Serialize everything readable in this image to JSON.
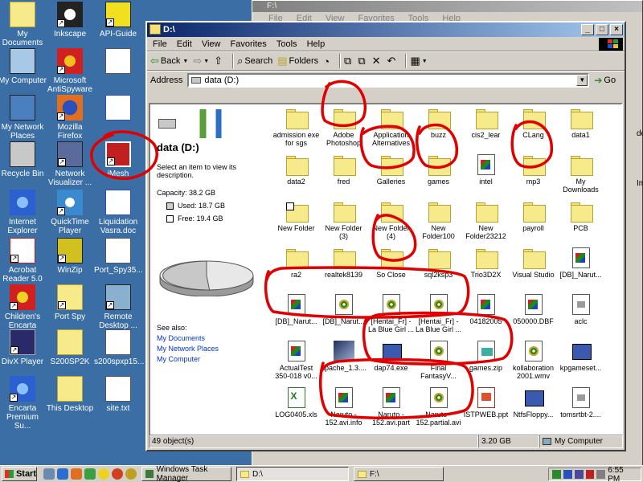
{
  "desktop": {
    "icons": [
      {
        "label": "My Documents"
      },
      {
        "label": "Inkscape"
      },
      {
        "label": "API-Guide"
      },
      {
        "label": "My Computer"
      },
      {
        "label": "Microsoft AntiSpyware"
      },
      {
        "label": ""
      },
      {
        "label": "My Network Places"
      },
      {
        "label": "Mozilla Firefox"
      },
      {
        "label": ""
      },
      {
        "label": "Recycle Bin"
      },
      {
        "label": "Network Visualizer ..."
      },
      {
        "label": "iMesh"
      },
      {
        "label": "Internet Explorer"
      },
      {
        "label": "QuickTime Player"
      },
      {
        "label": "Liquidation Vasra.doc"
      },
      {
        "label": "Acrobat Reader 5.0"
      },
      {
        "label": "WinZip"
      },
      {
        "label": "Port_Spy35..."
      },
      {
        "label": "Children's Encarta"
      },
      {
        "label": "Port Spy"
      },
      {
        "label": "Remote Desktop ..."
      },
      {
        "label": "DivX Player"
      },
      {
        "label": "S200SP2K"
      },
      {
        "label": "s200spxp15..."
      },
      {
        "label": "Encarta Premium Su..."
      },
      {
        "label": "This Desktop"
      },
      {
        "label": "site.txt"
      }
    ]
  },
  "back_window": {
    "title": "F:\\",
    "menu": [
      "File",
      "Edit",
      "View",
      "Favorites",
      "Tools",
      "Help"
    ],
    "edge_texts": [
      "do",
      "Ima"
    ]
  },
  "window": {
    "title": "D:\\",
    "menu": [
      "File",
      "Edit",
      "View",
      "Favorites",
      "Tools",
      "Help"
    ],
    "toolbar": {
      "back": "Back",
      "search": "Search",
      "folders": "Folders"
    },
    "address_label": "Address",
    "address_value": "data (D:)",
    "go_label": "Go",
    "left_pane": {
      "drive_title": "data (D:)",
      "description": "Select an item to view its description.",
      "capacity": "Capacity: 38.2 GB",
      "used": "Used: 18.7 GB",
      "free": "Free: 19.4 GB",
      "used_fraction": 0.49,
      "see_also_heading": "See also:",
      "links": [
        "My Documents",
        "My Network Places",
        "My Computer"
      ]
    },
    "files": [
      {
        "name": "admission exe for sgs",
        "type": "folder"
      },
      {
        "name": "Adobe Photoshop",
        "type": "folder"
      },
      {
        "name": "Application Alternatives",
        "type": "folder"
      },
      {
        "name": "buzz",
        "type": "folder"
      },
      {
        "name": "cis2_lear",
        "type": "folder"
      },
      {
        "name": "CLang",
        "type": "folder"
      },
      {
        "name": "data1",
        "type": "folder"
      },
      {
        "name": "data2",
        "type": "folder"
      },
      {
        "name": "fred",
        "type": "folder"
      },
      {
        "name": "Galleries",
        "type": "folder"
      },
      {
        "name": "games",
        "type": "folder"
      },
      {
        "name": "intel",
        "type": "doc"
      },
      {
        "name": "mp3",
        "type": "folder"
      },
      {
        "name": "My Downloads",
        "type": "folder"
      },
      {
        "name": "New Folder",
        "type": "folder-special"
      },
      {
        "name": "New Folder (3)",
        "type": "folder"
      },
      {
        "name": "New Folder (4)",
        "type": "folder"
      },
      {
        "name": "New Folder100",
        "type": "folder"
      },
      {
        "name": "New Folder23212",
        "type": "folder"
      },
      {
        "name": "payroll",
        "type": "folder"
      },
      {
        "name": "PCB",
        "type": "folder"
      },
      {
        "name": "ra2",
        "type": "folder"
      },
      {
        "name": "realtek8139",
        "type": "folder"
      },
      {
        "name": "So Close",
        "type": "folder"
      },
      {
        "name": "sql2ksp3",
        "type": "folder"
      },
      {
        "name": "Trio3D2X",
        "type": "folder"
      },
      {
        "name": "Visual Studio",
        "type": "folder"
      },
      {
        "name": "[DB]_Narut...",
        "type": "doc"
      },
      {
        "name": "[DB]_Narut...",
        "type": "doc"
      },
      {
        "name": "[DB]_Narut...",
        "type": "media"
      },
      {
        "name": "[Hentai_Fr] - La Blue Girl ...",
        "type": "media"
      },
      {
        "name": "[Hentai_Fr] - La Blue Girl ...",
        "type": "media"
      },
      {
        "name": "04182005",
        "type": "doc"
      },
      {
        "name": "050000.DBF",
        "type": "doc"
      },
      {
        "name": "aclc",
        "type": "sysfile"
      },
      {
        "name": "ActualTest 350-018 v0...",
        "type": "doc"
      },
      {
        "name": "apache_1.3....",
        "type": "apache"
      },
      {
        "name": "dap74.exe",
        "type": "exe"
      },
      {
        "name": "Final FantasyV...",
        "type": "media"
      },
      {
        "name": "games.zip",
        "type": "zip"
      },
      {
        "name": "kollaboration 2001.wmv",
        "type": "media"
      },
      {
        "name": "kpgameset...",
        "type": "exe"
      },
      {
        "name": "LOG0405.xls",
        "type": "xls"
      },
      {
        "name": "Naruto - 152.avi.info",
        "type": "doc"
      },
      {
        "name": "Naruto - 152.avi.part",
        "type": "doc"
      },
      {
        "name": "Naruto - 152.partial.avi",
        "type": "media"
      },
      {
        "name": "ISTPWEB.ppt",
        "type": "ppt"
      },
      {
        "name": "NtfsFloppy...",
        "type": "exe"
      },
      {
        "name": "tomsrtbt-2....",
        "type": "sysfile"
      }
    ],
    "status": {
      "objects": "49 object(s)",
      "size": "3.20 GB",
      "zone": "My Computer"
    }
  },
  "taskbar": {
    "start": "Start",
    "tasks": [
      {
        "label": "Windows Task Manager"
      },
      {
        "label": "D:\\"
      },
      {
        "label": "F:\\"
      }
    ],
    "clock": "6:55 PM"
  },
  "colors": {
    "desktop": "#3a6ea5",
    "title_active": "#0a246a",
    "annotation": "#e00000"
  }
}
